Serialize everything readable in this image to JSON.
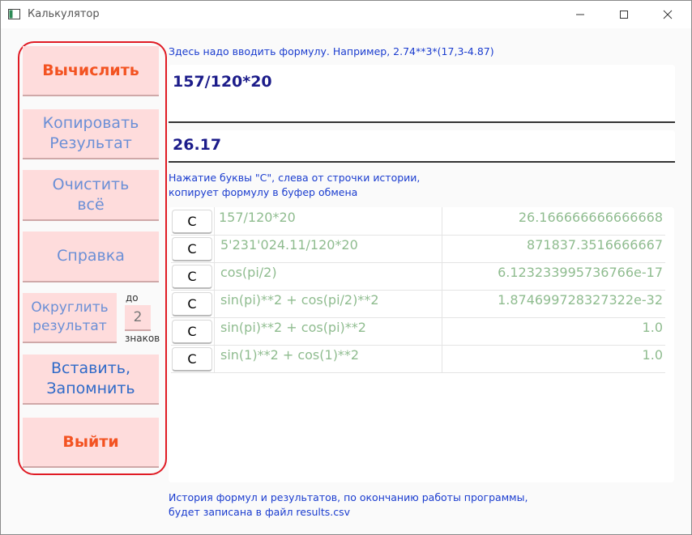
{
  "window": {
    "title": "Калькулятор",
    "icon": "app-window-icon",
    "controls": [
      "minimize-icon",
      "maximize-icon",
      "close-icon"
    ]
  },
  "left": {
    "calculate": "Вычислить",
    "copy_line1": "Копировать",
    "copy_line2": "Результат",
    "clear_line1": "Очистить",
    "clear_line2": "всё",
    "help": "Справка",
    "round_line1": "Округлить",
    "round_line2": "результат",
    "round_prefix": "до",
    "round_digits": "2",
    "round_suffix": "знаков",
    "paste_line1": "Вставить,",
    "paste_line2": "Запомнить",
    "exit": "Выйти"
  },
  "main": {
    "formula_hint": "Здесь надо вводить формулу. Например, 2.74**3*(17,3-4.87)",
    "formula_value": "157/120*20",
    "result_value": "26.17",
    "history_hint_line1": "Нажатие буквы \"C\", слева от строчки истории,",
    "history_hint_line2": "копирует формулу в буфер обмена",
    "footer_line1": "История формул и результатов, по окончанию работы программы,",
    "footer_line2": "будет записана в файл results.csv"
  },
  "history": [
    {
      "button": "C",
      "formula": "157/120*20",
      "result": "26.166666666666668"
    },
    {
      "button": "C",
      "formula": "5'231'024.11/120*20",
      "result": "871837.3516666667"
    },
    {
      "button": "C",
      "formula": "cos(pi/2)",
      "result": "6.123233995736766e-17"
    },
    {
      "button": "C",
      "formula": "sin(pi)**2 + cos(pi/2)**2",
      "result": "1.874699728327322e-32"
    },
    {
      "button": "C",
      "formula": "sin(pi)**2 + cos(pi)**2",
      "result": "1.0"
    },
    {
      "button": "C",
      "formula": "sin(1)**2 + cos(1)**2",
      "result": "1.0"
    }
  ],
  "colors": {
    "panel_border": "#e01b24",
    "button_bg": "#fedcdc",
    "accent_red": "#f35322",
    "text_blue": "#1a3ccf",
    "history_green": "#8fbc8f"
  }
}
